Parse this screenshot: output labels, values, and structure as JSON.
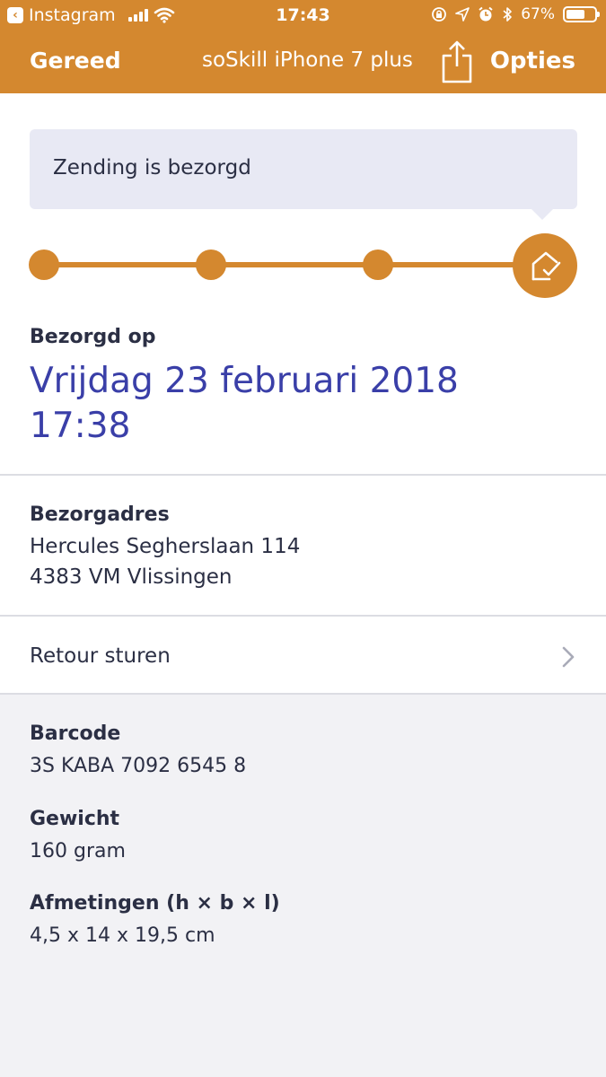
{
  "status_bar": {
    "back_app": "Instagram",
    "time": "17:43",
    "battery": "67%",
    "battery_level": 0.67
  },
  "nav": {
    "done": "Gereed",
    "title": "soSkill iPhone 7 plus",
    "options": "Opties"
  },
  "colors": {
    "accent": "#d4882f",
    "date_blue": "#3a3fa8",
    "bubble_bg": "#e8e9f4",
    "details_bg": "#f2f2f5"
  },
  "shipment": {
    "status_message": "Zending is bezorgd",
    "steps_total": 4,
    "current_step": 4,
    "delivered_label": "Bezorgd op",
    "delivered_date": "Vrijdag 23 februari 2018",
    "delivered_time": "17:38"
  },
  "address": {
    "label": "Bezorgadres",
    "line1": "Hercules Segherslaan 114",
    "line2": "4383 VM Vlissingen"
  },
  "return": {
    "label": "Retour sturen"
  },
  "details": {
    "barcode_label": "Barcode",
    "barcode_value": "3S KABA 7092 6545 8",
    "weight_label": "Gewicht",
    "weight_value": "160 gram",
    "dimensions_label": "Afmetingen (h × b × l)",
    "dimensions_value": "4,5 x 14 x 19,5 cm"
  }
}
